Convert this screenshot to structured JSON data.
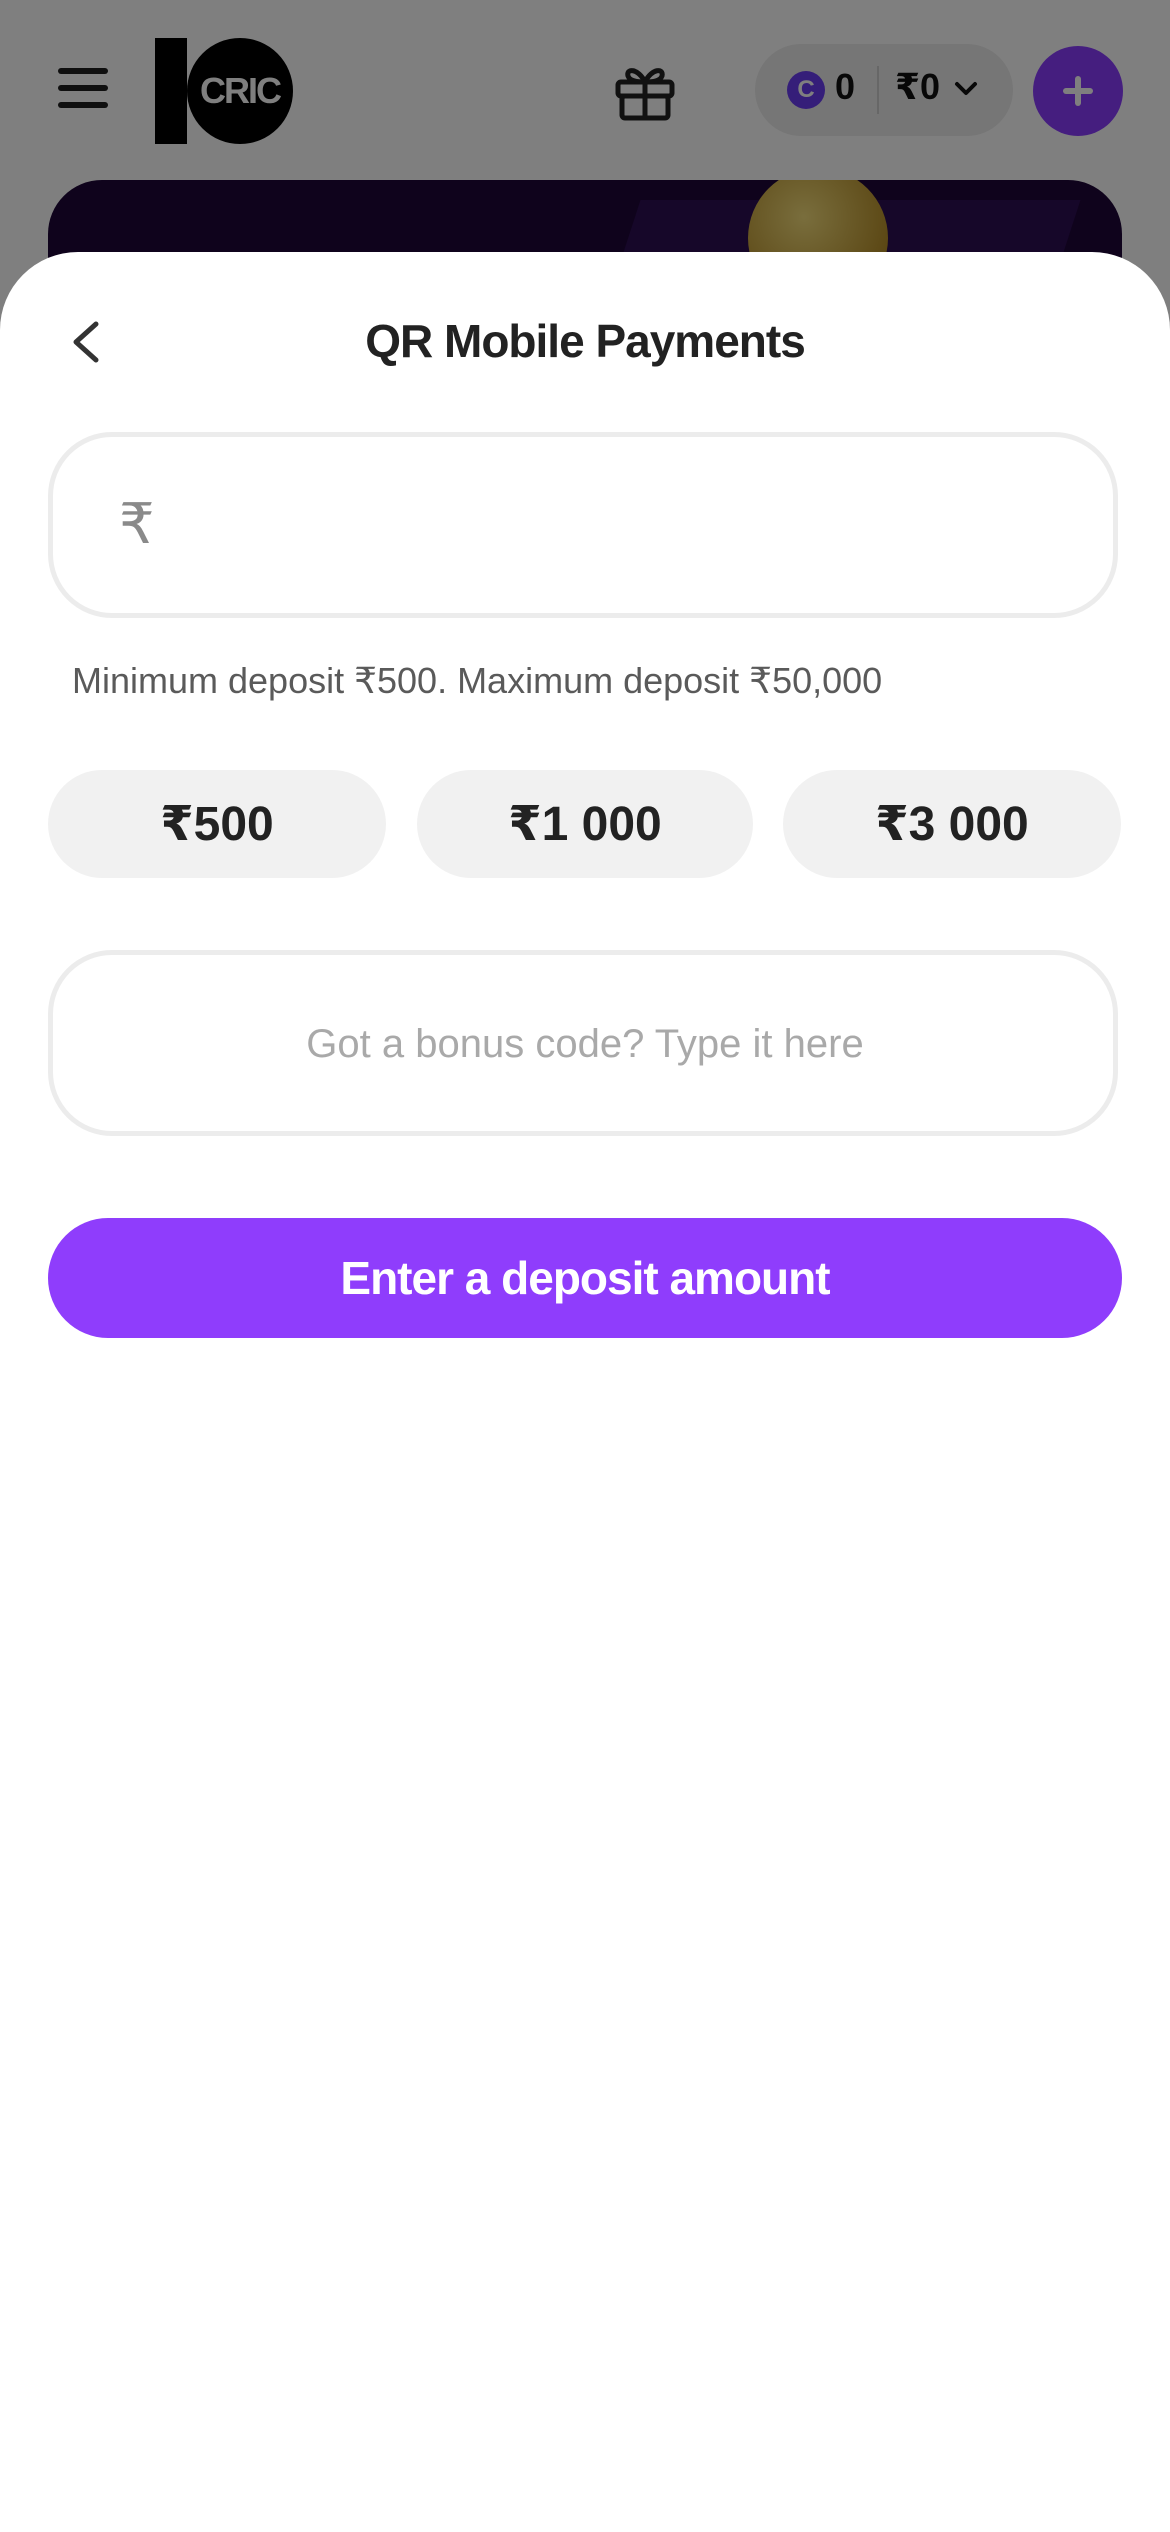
{
  "header": {
    "logo_text": "CRIC",
    "coins": "0",
    "balance": "₹0"
  },
  "sheet": {
    "title": "QR Mobile Payments",
    "amount_field": {
      "currency_symbol": "₹",
      "value": ""
    },
    "limits_text": "Minimum deposit ₹500. Maximum deposit ₹50,000",
    "quick_amounts": [
      {
        "label": "₹500"
      },
      {
        "label": "₹1 000"
      },
      {
        "label": "₹3 000"
      }
    ],
    "bonus_field": {
      "placeholder": "Got a bonus code? Type it here",
      "value": ""
    },
    "submit_label": "Enter a deposit amount"
  },
  "colors": {
    "accent": "#8f3dfc",
    "banner": "#1e0638"
  }
}
